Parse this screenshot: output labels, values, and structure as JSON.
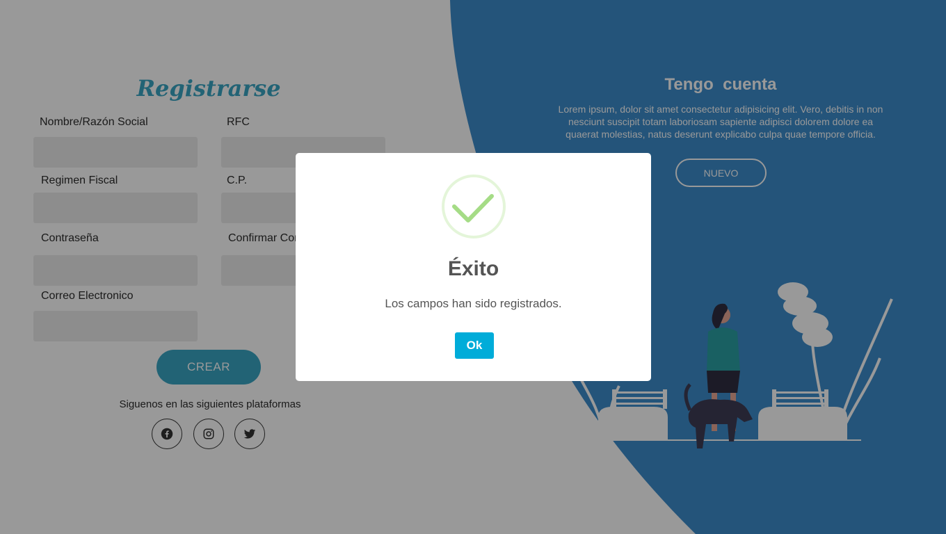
{
  "register": {
    "title": "Registrarse",
    "fields": {
      "nombre_label": "Nombre/Razón Social",
      "rfc_label": "RFC",
      "regimen_label": "Regimen Fiscal",
      "cp_label": "C.P.",
      "password_label": "Contraseña",
      "confirm_password_label": "Confirmar Contraseña",
      "email_label": "Correo Electronico"
    },
    "submit_label": "CREAR",
    "social_text": "Siguenos en las siguientes plataformas",
    "social_icons": [
      "facebook-icon",
      "instagram-icon",
      "twitter-icon"
    ]
  },
  "panel": {
    "title": "Tengo  cuenta",
    "text": "Lorem ipsum, dolor sit amet consectetur adipisicing elit. Vero, debitis in non nesciunt suscipit totam laboriosam sapiente adipisci dolorem dolore ea quaerat molestias, natus deserunt explicabo culpa quae tempore officia.",
    "button_label": "NUEVO"
  },
  "modal": {
    "icon": "success-check-icon",
    "title": "Éxito",
    "message": "Los campos han sido registrados.",
    "ok_label": "Ok"
  },
  "colors": {
    "accent": "#3aa5c4",
    "panel_blue": "#3c8ccb",
    "ok_button": "#00acd9",
    "success_green": "#a5dc86"
  }
}
